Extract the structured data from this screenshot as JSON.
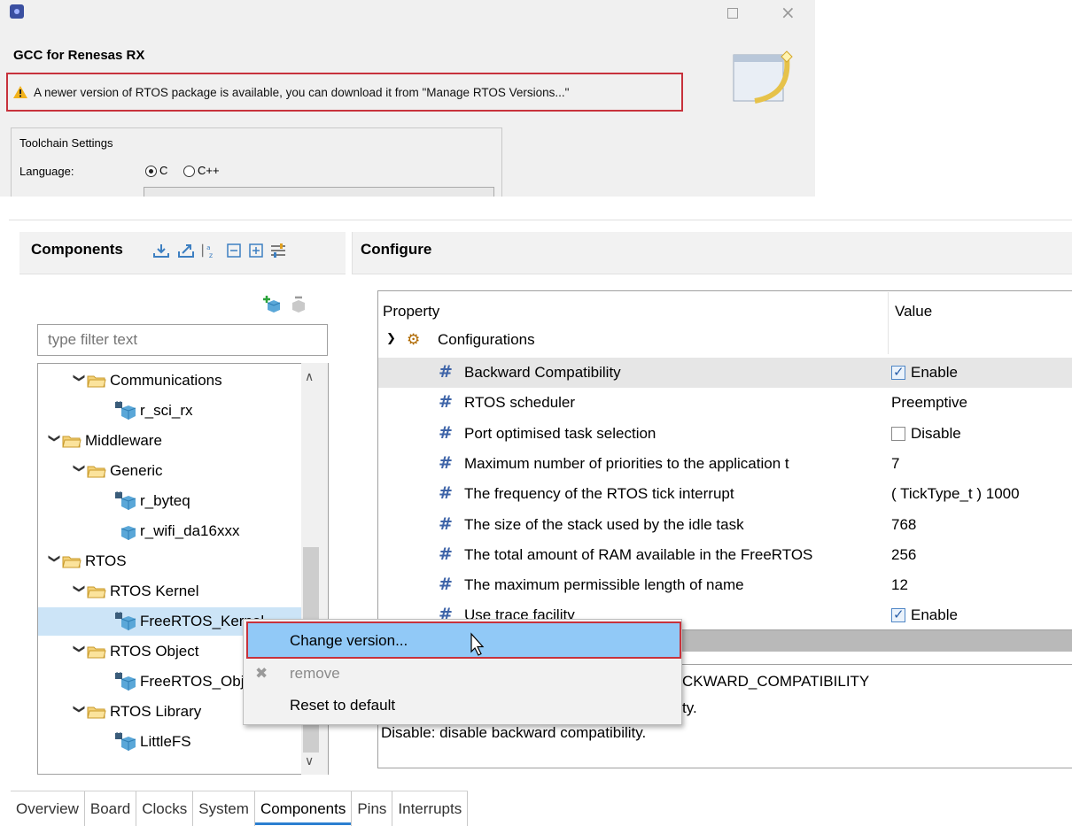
{
  "dialog": {
    "title": "GCC for Renesas RX",
    "warning": "A newer version of RTOS package is available, you can download it from \"Manage RTOS Versions...\"",
    "toolchain_group": "Toolchain Settings",
    "language_label": "Language:",
    "radio_c": "C",
    "radio_cpp": "C++",
    "selected_language": "C"
  },
  "components": {
    "title": "Components",
    "filter_placeholder": "type filter text",
    "tree": [
      {
        "label": "Communications",
        "kind": "folder",
        "level": 1,
        "expanded": true
      },
      {
        "label": "r_sci_rx",
        "kind": "component",
        "level": 2,
        "locked": true
      },
      {
        "label": "Middleware",
        "kind": "folder",
        "level": 0,
        "expanded": true
      },
      {
        "label": "Generic",
        "kind": "folder",
        "level": 1,
        "expanded": true
      },
      {
        "label": "r_byteq",
        "kind": "component",
        "level": 2,
        "locked": true
      },
      {
        "label": "r_wifi_da16xxx",
        "kind": "component",
        "level": 2,
        "locked": false
      },
      {
        "label": "RTOS",
        "kind": "folder",
        "level": 0,
        "expanded": true
      },
      {
        "label": "RTOS Kernel",
        "kind": "folder",
        "level": 1,
        "expanded": true
      },
      {
        "label": "FreeRTOS_Kernel",
        "kind": "component",
        "level": 2,
        "locked": true,
        "selected": true
      },
      {
        "label": "RTOS Object",
        "kind": "folder",
        "level": 1,
        "expanded": true
      },
      {
        "label": "FreeRTOS_Object",
        "kind": "component",
        "level": 2,
        "locked": true
      },
      {
        "label": "RTOS Library",
        "kind": "folder",
        "level": 1,
        "expanded": true
      },
      {
        "label": "LittleFS",
        "kind": "component",
        "level": 2,
        "locked": true
      }
    ]
  },
  "configure": {
    "title": "Configure",
    "col_property": "Property",
    "col_value": "Value",
    "group_label": "Configurations",
    "rows": [
      {
        "name": "Backward Compatibility",
        "value": "Enable",
        "checkbox": true,
        "checked": true,
        "highlight": true
      },
      {
        "name": "RTOS scheduler",
        "value": "Preemptive",
        "checkbox": false
      },
      {
        "name": "Port optimised task selection",
        "value": "Disable",
        "checkbox": true,
        "checked": false
      },
      {
        "name": "Maximum number of priorities to the application t",
        "value": "7",
        "checkbox": false
      },
      {
        "name": "The frequency of the RTOS tick interrupt",
        "value": "( TickType_t ) 1000",
        "checkbox": false
      },
      {
        "name": "The size of the stack used by the idle task",
        "value": "768",
        "checkbox": false
      },
      {
        "name": "The total amount of RAM available in the FreeRTOS",
        "value": "256",
        "checkbox": false
      },
      {
        "name": "The maximum permissible length of name",
        "value": "12",
        "checkbox": false
      },
      {
        "name": "Use trace facility",
        "value": "Enable",
        "checkbox": true,
        "checked": true
      }
    ],
    "description": {
      "line1": "CKWARD_COMPATIBILITY",
      "line2": "ty.",
      "line3": "Disable: disable backward compatibility."
    }
  },
  "context_menu": {
    "change_version": "Change version...",
    "remove": "remove",
    "reset": "Reset to default"
  },
  "tabs": [
    {
      "label": "Overview",
      "active": false
    },
    {
      "label": "Board",
      "active": false
    },
    {
      "label": "Clocks",
      "active": false
    },
    {
      "label": "System",
      "active": false
    },
    {
      "label": "Components",
      "active": true
    },
    {
      "label": "Pins",
      "active": false
    },
    {
      "label": "Interrupts",
      "active": false
    }
  ]
}
